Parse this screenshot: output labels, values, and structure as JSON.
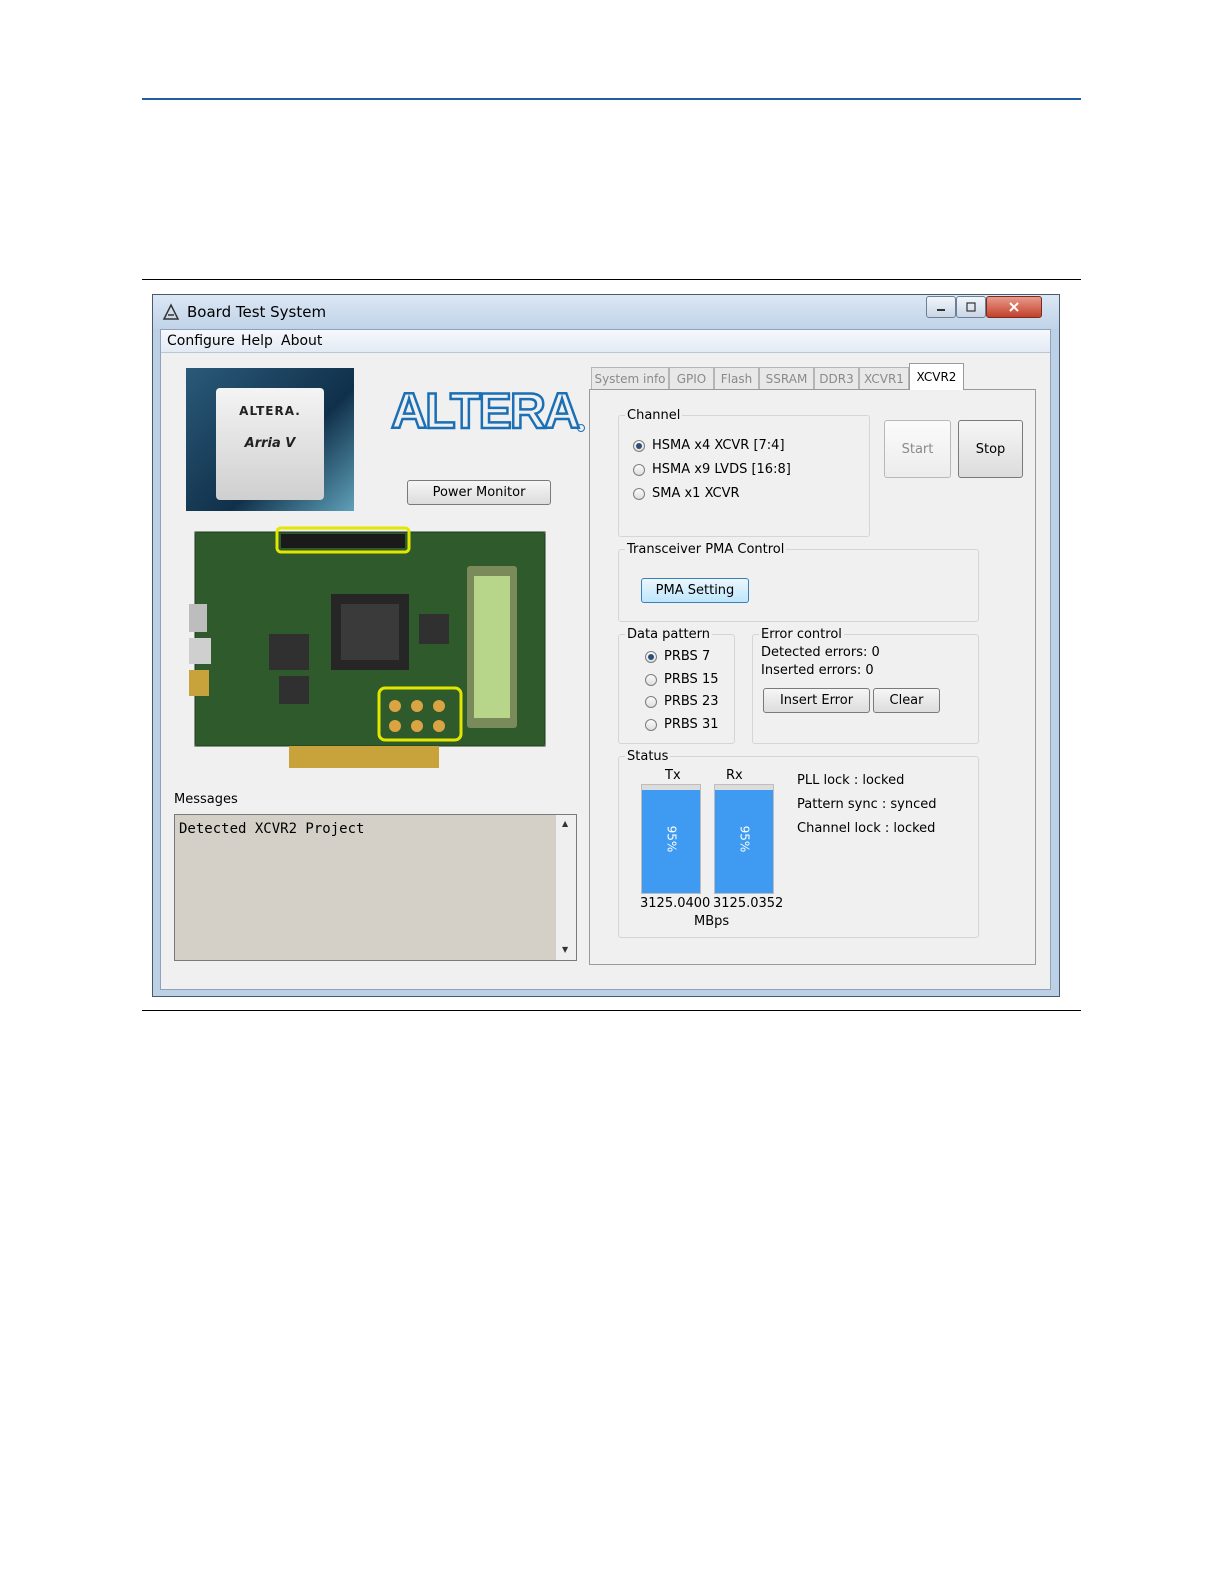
{
  "window": {
    "title": "Board Test System"
  },
  "menu": [
    "Configure",
    "Help",
    "About"
  ],
  "chip": {
    "logo": "ALTERA.",
    "name": "Arria V"
  },
  "logo_text": "ALTERA",
  "power_monitor_label": "Power Monitor",
  "messages": {
    "label": "Messages",
    "text": "Detected XCVR2 Project"
  },
  "tabs": [
    {
      "label": "System info",
      "active": false
    },
    {
      "label": "GPIO",
      "active": false
    },
    {
      "label": "Flash",
      "active": false
    },
    {
      "label": "SSRAM",
      "active": false
    },
    {
      "label": "DDR3",
      "active": false
    },
    {
      "label": "XCVR1",
      "active": false
    },
    {
      "label": "XCVR2",
      "active": true
    }
  ],
  "channel": {
    "label": "Channel",
    "options": [
      {
        "label": "HSMA x4 XCVR [7:4]",
        "selected": true
      },
      {
        "label": "HSMA x9 LVDS [16:8]",
        "selected": false
      },
      {
        "label": "SMA x1 XCVR",
        "selected": false
      }
    ]
  },
  "start_label": "Start",
  "stop_label": "Stop",
  "pma": {
    "label": "Transceiver PMA Control",
    "button": "PMA Setting"
  },
  "data_pattern": {
    "label": "Data pattern",
    "options": [
      {
        "label": "PRBS 7",
        "selected": true
      },
      {
        "label": "PRBS 15",
        "selected": false
      },
      {
        "label": "PRBS 23",
        "selected": false
      },
      {
        "label": "PRBS 31",
        "selected": false
      }
    ]
  },
  "error_control": {
    "label": "Error control",
    "detected": "Detected errors: 0",
    "inserted": "Inserted errors: 0",
    "insert_button": "Insert Error",
    "clear_button": "Clear"
  },
  "status": {
    "label": "Status",
    "tx": {
      "label": "Tx",
      "percent_text": "95%",
      "percent": 95,
      "rate": "3125.0400"
    },
    "rx": {
      "label": "Rx",
      "percent_text": "95%",
      "percent": 95,
      "rate": "3125.0352"
    },
    "unit": "MBps",
    "pll_lock": "PLL lock : locked",
    "pattern_sync": "Pattern sync : synced",
    "channel_lock": "Channel lock : locked"
  },
  "colors": {
    "meter_fill": "#3f9bf2",
    "rule": "#1f5f9f"
  }
}
